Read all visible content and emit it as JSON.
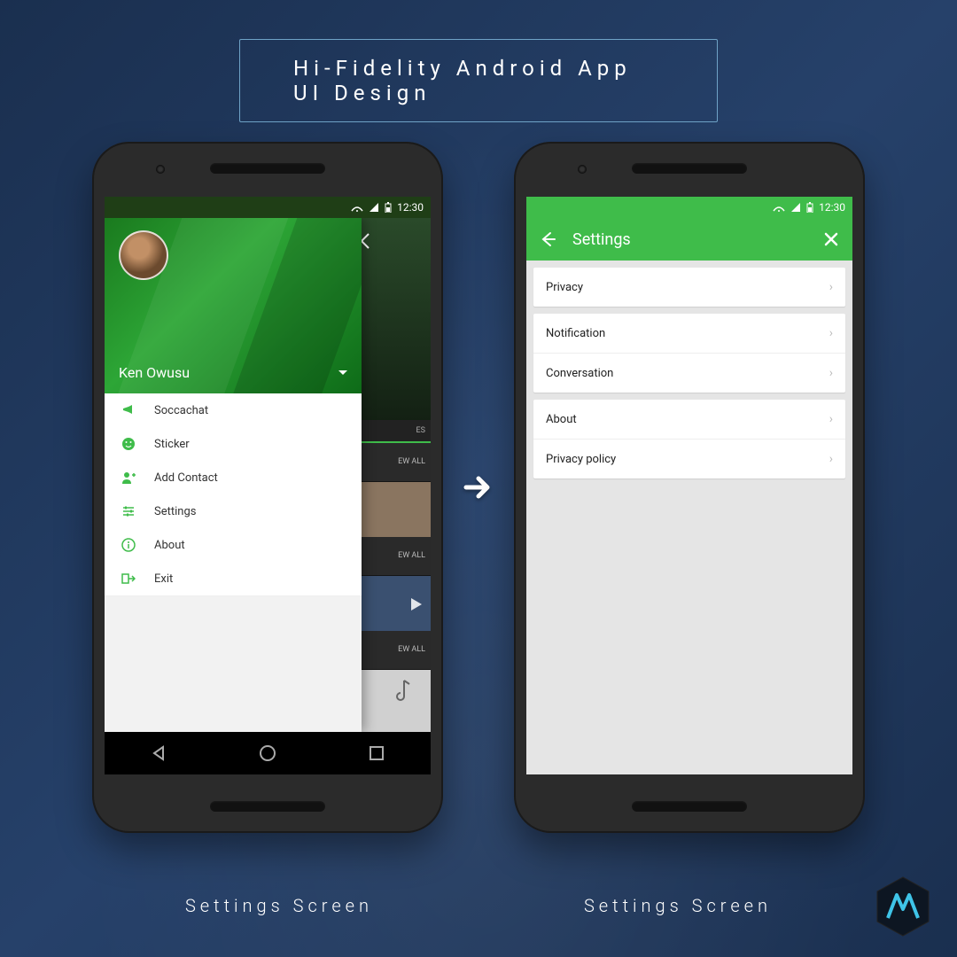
{
  "page_title": "Hi-Fidelity Android App UI Design",
  "captions": [
    "Settings Screen",
    "Settings Screen"
  ],
  "status": {
    "time": "12:30"
  },
  "drawer": {
    "username": "Ken Owusu",
    "items": [
      {
        "label": "Soccachat"
      },
      {
        "label": "Sticker"
      },
      {
        "label": "Add Contact"
      },
      {
        "label": "Settings"
      },
      {
        "label": "About"
      },
      {
        "label": "Exit"
      }
    ]
  },
  "peek": {
    "tab_label": "ES",
    "row_label": "EW ALL"
  },
  "settings": {
    "title": "Settings",
    "groups": [
      [
        "Privacy"
      ],
      [
        "Notification",
        "Conversation"
      ],
      [
        "About",
        "Privacy policy"
      ]
    ]
  }
}
